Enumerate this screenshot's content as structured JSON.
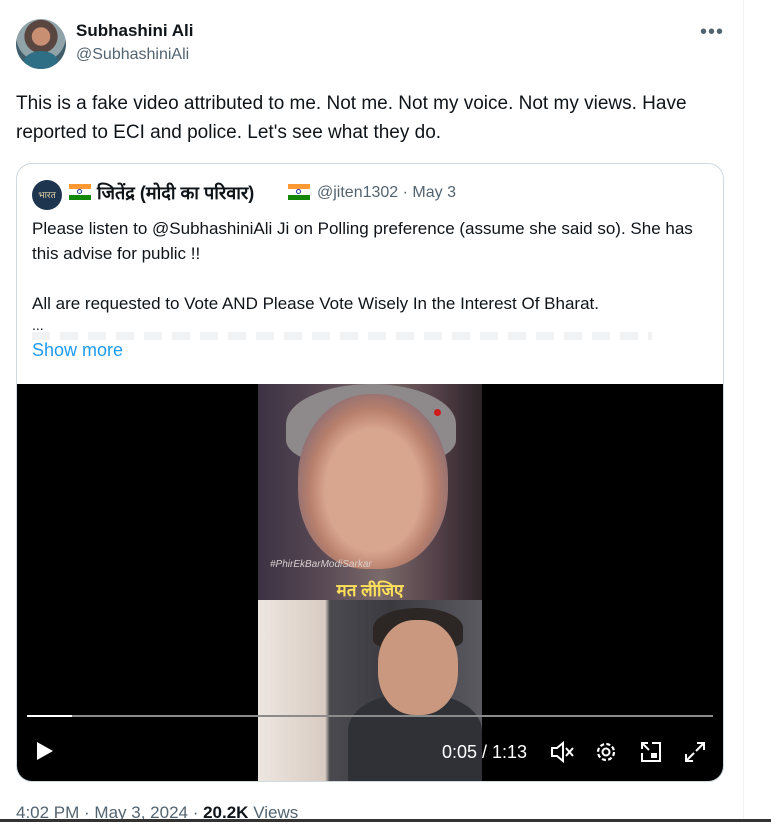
{
  "author": {
    "name": "Subhashini Ali",
    "handle": "@SubhashiniAli"
  },
  "more_icon": "more-horizontal-icon",
  "tweet_text": "This is a fake video attributed to me. Not me. Not my voice. Not my views. Have reported to ECI and police. Let's see what they do.",
  "quote": {
    "avatar_text": "भारत",
    "name": "जितेंद्र (मोदी का परिवार)",
    "handle_date": "@jiten1302 · May 3",
    "text_line1": "Please listen to @SubhashiniAli  Ji on Polling preference (assume she said so). She has this advise for public !!",
    "text_line2": "All are requested to Vote AND Please Vote Wisely In the Interest Of Bharat.",
    "ellipsis": "...",
    "show_more": "Show more"
  },
  "video": {
    "hashtag": "#PhirEkBarModiSarkar",
    "caption": "मत लीजिए",
    "time": "0:05 / 1:13",
    "progress": 0.065,
    "controls": [
      "play-icon",
      "mute-icon",
      "settings-icon",
      "pip-icon",
      "fullscreen-icon"
    ]
  },
  "footer": {
    "time": "4:02 PM · May 3, 2024 · ",
    "views_count": "20.2K",
    "views_label": " Views"
  },
  "colors": {
    "link": "#1d9bf0",
    "secondary_text": "#536471",
    "flag_saffron": "#ff9933",
    "flag_green": "#138808",
    "caption_yellow": "#ffe15a"
  }
}
